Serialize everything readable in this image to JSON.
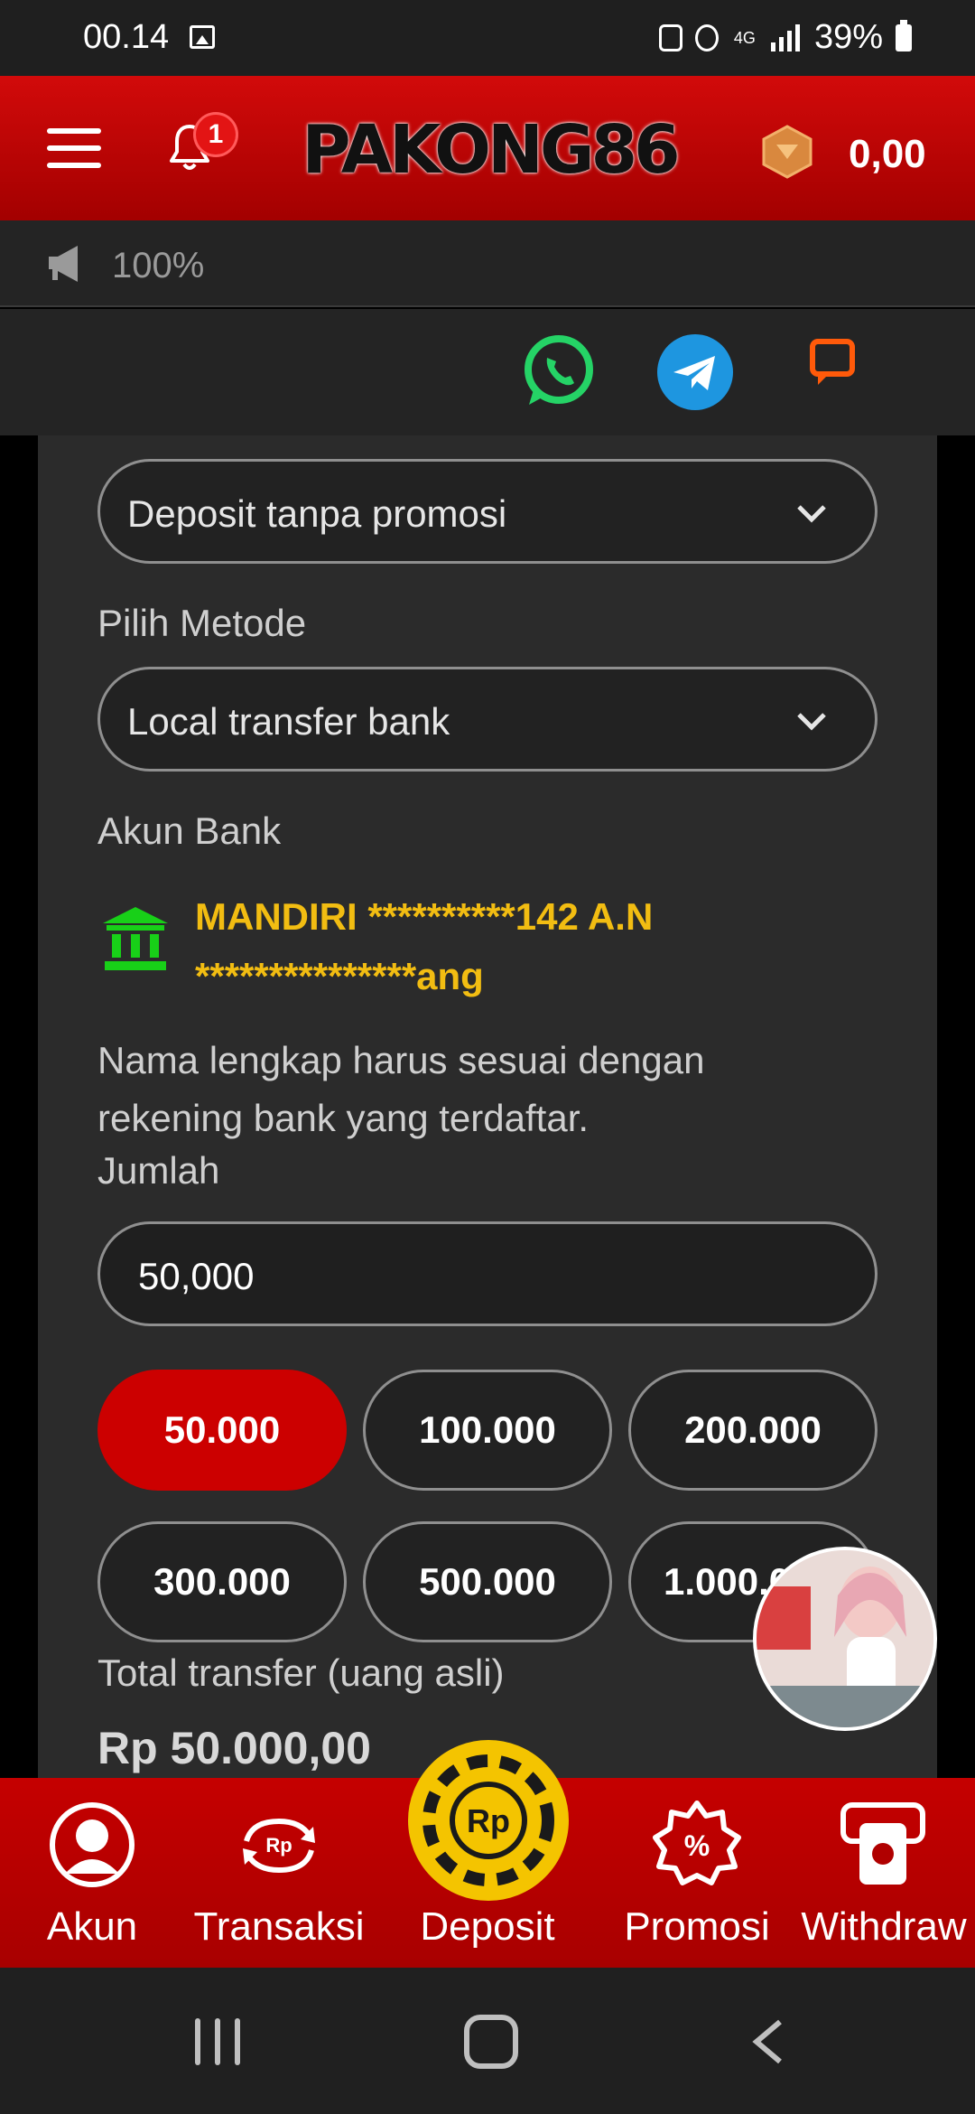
{
  "status_bar": {
    "time": "00.14",
    "network": "4G",
    "battery": "39%"
  },
  "header": {
    "notification_count": "1",
    "logo_text": "PAKONG86",
    "balance": "0,00"
  },
  "marquee": {
    "text": "100%"
  },
  "form": {
    "promo_select": "Deposit tanpa promosi",
    "method_label": "Pilih Metode",
    "method_select": "Local transfer bank",
    "bank_label": "Akun Bank",
    "bank_account": "MANDIRI **********142 A.N ***************ang",
    "note": "Nama lengkap harus sesuai dengan rekening bank yang terdaftar.",
    "amount_label": "Jumlah",
    "amount_value": "50,000",
    "chips": [
      "50.000",
      "100.000",
      "200.000",
      "300.000",
      "500.000",
      "1.000.000"
    ],
    "selected_chip": "50.000",
    "total_label": "Total transfer (uang asli)",
    "total_value": "Rp 50.000,00"
  },
  "bottom_nav": {
    "items": [
      {
        "label": "Akun",
        "icon": "user-icon"
      },
      {
        "label": "Transaksi",
        "icon": "transaction-icon"
      },
      {
        "label": "Deposit",
        "icon": "deposit-coin-icon"
      },
      {
        "label": "Promosi",
        "icon": "promo-icon"
      },
      {
        "label": "Withdraw",
        "icon": "withdraw-icon"
      }
    ]
  },
  "colors": {
    "brand_red": "#cc0000",
    "accent_gold": "#f2bd12",
    "card_bg": "#2b2b2b"
  }
}
